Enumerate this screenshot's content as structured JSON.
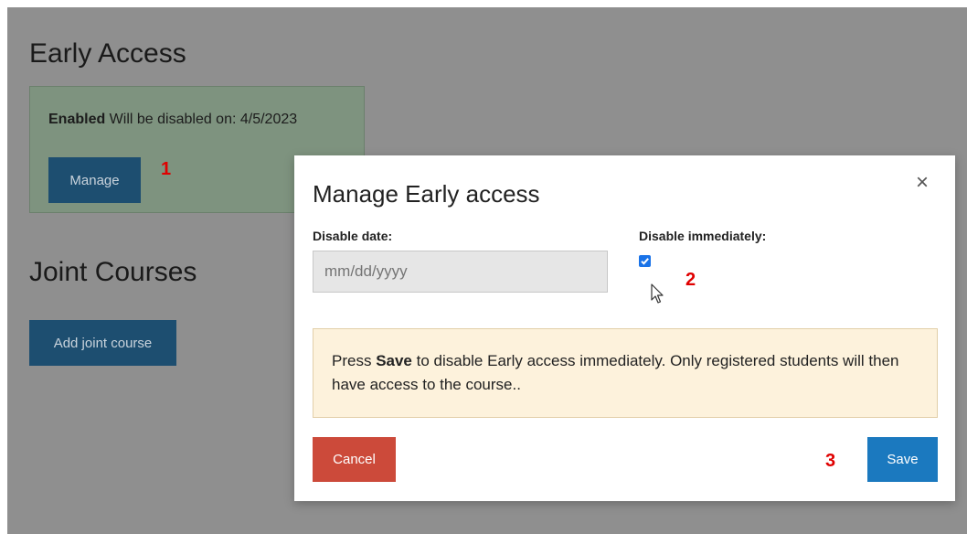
{
  "early_access": {
    "heading": "Early Access",
    "status_bold": "Enabled",
    "status_text": " Will be disabled on: 4/5/2023",
    "manage_button": "Manage"
  },
  "joint_courses": {
    "heading": "Joint Courses",
    "add_button": "Add joint course"
  },
  "steps": [
    "1",
    "2",
    "3"
  ],
  "modal": {
    "title": "Manage Early access",
    "close_glyph": "×",
    "disable_date_label": "Disable date:",
    "disable_date_placeholder": "mm/dd/yyyy",
    "disable_date_value": "",
    "disable_immediately_label": "Disable immediately:",
    "disable_immediately_checked": true,
    "alert_pre": "Press ",
    "alert_bold": "Save",
    "alert_post": " to disable Early access immediately. Only registered students will then have access to the course..",
    "cancel_button": "Cancel",
    "save_button": "Save"
  },
  "colors": {
    "overlay": "#8f8f8f",
    "primary": "#1b79bf",
    "danger": "#cc4a3a",
    "alert_bg": "#fdf2dc",
    "step_marker": "#e00000"
  },
  "icons": {
    "close": "close-icon",
    "checkbox": "checkmark-icon",
    "cursor": "mouse-pointer-icon"
  }
}
